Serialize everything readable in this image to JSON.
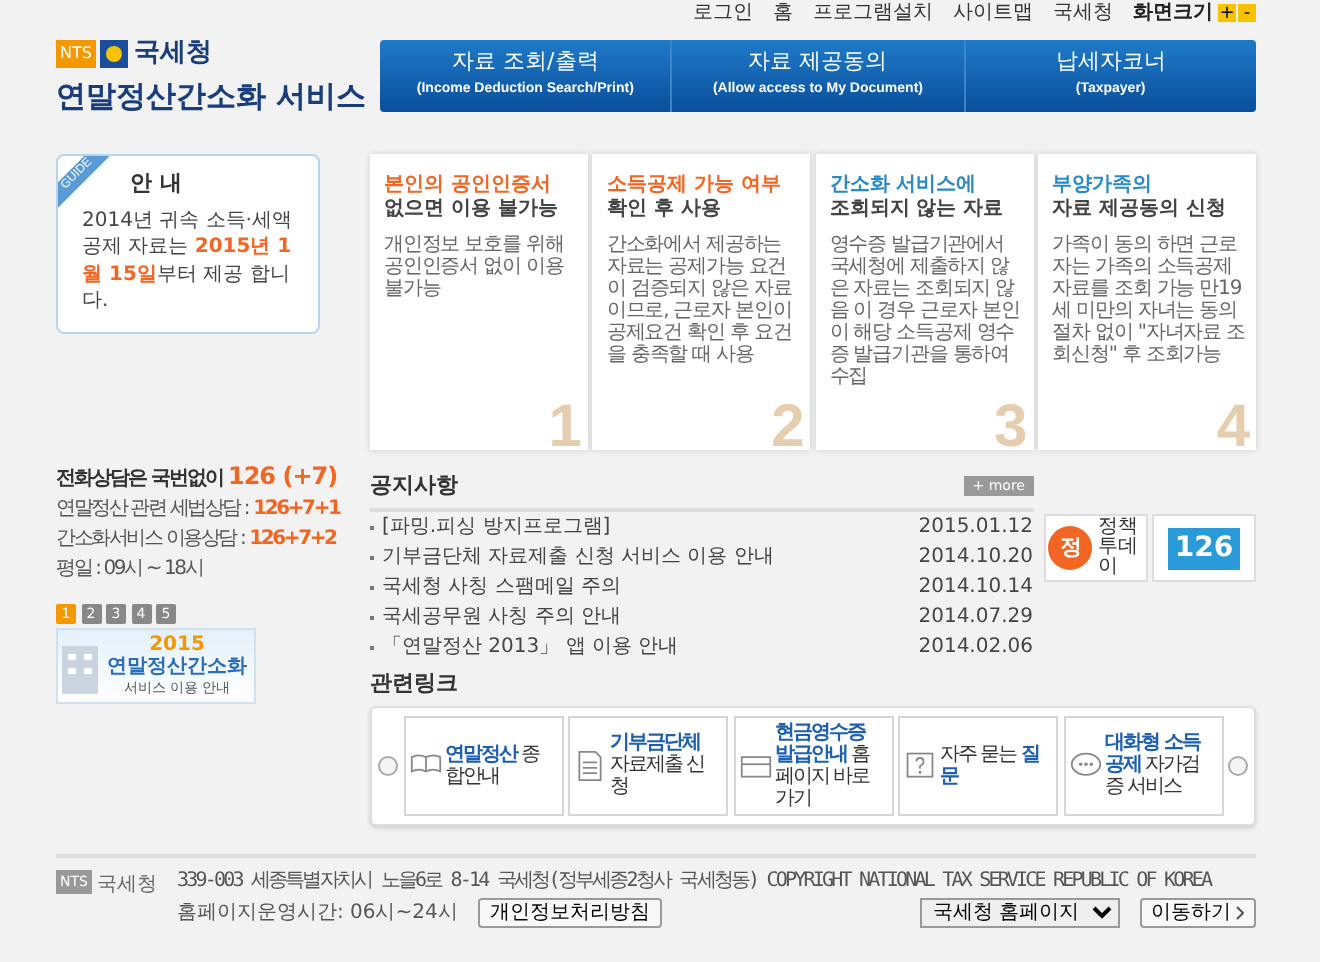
{
  "top_links": [
    {
      "label": "로그인"
    },
    {
      "label": "홈"
    },
    {
      "label": "프로그램설치"
    },
    {
      "label": "사이트맵"
    },
    {
      "label": "국세청"
    }
  ],
  "font_size": {
    "label": "화면크기",
    "plus": "+",
    "minus": "-"
  },
  "logo": {
    "badge": "NTS",
    "org": "국세청",
    "title": "연말정산간소화 서비스"
  },
  "nav": [
    {
      "label": "자료 조회/출력",
      "sub": "(Income Deduction Search/Print)"
    },
    {
      "label": "자료 제공동의",
      "sub": "(Allow access to My Document)"
    },
    {
      "label": "납세자코너",
      "sub": "(Taxpayer)"
    }
  ],
  "guide": {
    "badge": "GUIDE",
    "title": "안 내",
    "text": "2014년 귀속 소득·세액공제 자료는 **2015년 1월 15일**부터 제공 합니다."
  },
  "phone": {
    "headline": "전화상담은 국번없이",
    "number": "126 (+7)",
    "lines": [
      {
        "label": "연말정산 관련 세법상담 :",
        "value": "126+7+1"
      },
      {
        "label": "간소화서비스 이용상담 :",
        "value": "126+7+2"
      }
    ],
    "hours": "평일 : 09시 ~ 18시"
  },
  "banner": {
    "pages": [
      {
        "label": "1",
        "selected": true
      },
      {
        "label": "2",
        "selected": false
      },
      {
        "label": "3",
        "selected": false
      },
      {
        "label": "4",
        "selected": false
      },
      {
        "label": "5",
        "selected": false
      }
    ],
    "year": "2015",
    "title": "연말정산간소화",
    "subtitle": "서비스 이용 안내"
  },
  "cards": [
    {
      "title_1": "본인의 공인인증서",
      "title_2": "없으면 이용 불가능",
      "color": "#f26522",
      "body": "개인정보 보호를 위해 공인인증서 없이 이용 불가능",
      "number": "1"
    },
    {
      "title_1": "소득공제 가능 여부",
      "title_2": "확인 후 사용",
      "color": "#f26522",
      "body": "간소화에서 제공하는 자료는 공제가능 요건이 검증되지 않은 자료이므로, 근로자 본인이 공제요건 확인 후 요건을 충족할 때 사용",
      "number": "2"
    },
    {
      "title_1": "간소화 서비스에",
      "title_2": "조회되지 않는 자료",
      "color": "#2a8ac6",
      "body": "영수증 발급기관에서 국세청에 제출하지 않은 자료는 조회되지 않음 이 경우 근로자 본인이 해당 소득공제 영수증 발급기관을 통하여 수집",
      "number": "3"
    },
    {
      "title_1": "부양가족의",
      "title_2": "자료 제공동의 신청",
      "color": "#2a8ac6",
      "body": "가족이 동의 하면 근로자는 가족의 소득공제 자료를 조회 가능 만19세 미만의 자녀는 동의 절차 없이 \"자녀자료 조회신청\" 후 조회가능",
      "number": "4"
    }
  ],
  "notices": {
    "title": "공지사항",
    "more": "+ more",
    "items": [
      {
        "title": "[파밍.피싱 방지프로그램]",
        "date": "2015.01.12"
      },
      {
        "title": "기부금단체 자료제출 신청 서비스 이용 안내",
        "date": "2014.10.20"
      },
      {
        "title": "국세청 사칭 스팸메일 주의",
        "date": "2014.10.14"
      },
      {
        "title": "국세공무원 사칭 주의 안내",
        "date": "2014.07.29"
      },
      {
        "title": "「연말정산 2013」 앱 이용 안내",
        "date": "2014.02.06"
      }
    ]
  },
  "side_banners": [
    {
      "kind": "policy",
      "mark": "정",
      "label": "정책 투데이"
    },
    {
      "kind": "center",
      "label": "126"
    }
  ],
  "related": {
    "title": "관련링크",
    "items": [
      {
        "kind": "book",
        "text": "**연말정산** 종합안내"
      },
      {
        "kind": "document",
        "text": "**기부금단체** 자료제출 신청"
      },
      {
        "kind": "card",
        "text": "**현금영수증 발급안내** 홈페이지 바로가기"
      },
      {
        "kind": "question",
        "text": "자주 묻는 **질문**"
      },
      {
        "kind": "chat",
        "text": "**대화형 소득공제** 자가검증 서비스"
      }
    ]
  },
  "footer": {
    "badge": "NTS",
    "org": "국세청",
    "address": "339-003 세종특별자치시 노을6로 8-14 국세청(정부세종2청사 국세청동) COPYRIGHT NATIONAL TAX SERVICE REPUBLIC OF KOREA",
    "hours": "홈페이지운영시간: 06시~24시",
    "privacy": "개인정보처리방침",
    "select": "국세청 홈페이지",
    "go": "이동하기"
  }
}
